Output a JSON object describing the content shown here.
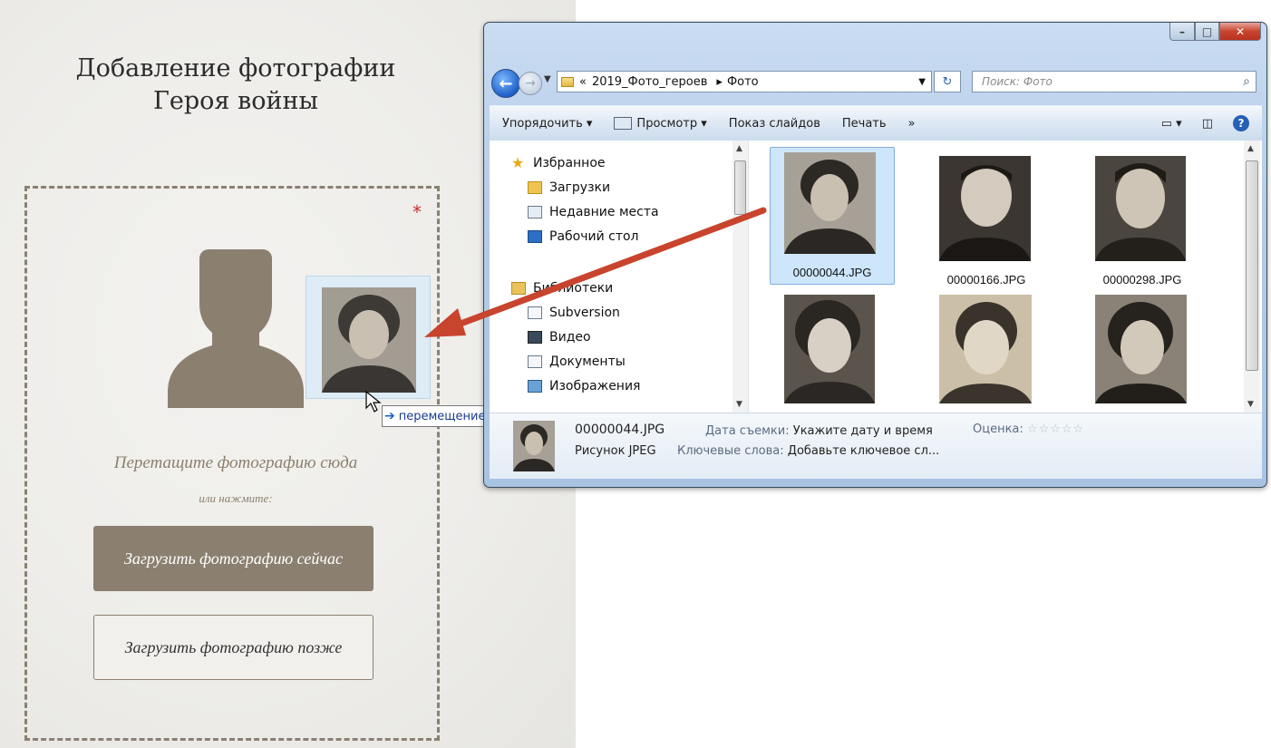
{
  "webpage": {
    "title_line1": "Добавление фотографии",
    "title_line2": "Героя войны",
    "required_mark": "*",
    "drop_hint": "Перетащите фотографию сюда",
    "or_click": "или нажмите:",
    "upload_now_label": "Загрузить фотографию сейчас",
    "upload_later_label": "Загрузить фотографию позже",
    "drag_tooltip": "перемещение",
    "accent_color": "#8b8070"
  },
  "explorer": {
    "address": {
      "overflow": "«",
      "crumbs": [
        "2019_Фото_героев",
        "Фото"
      ],
      "search_placeholder": "Поиск: Фото"
    },
    "toolbar": {
      "organize": "Упорядочить ▾",
      "view": "Просмотр ▾",
      "slideshow": "Показ слайдов",
      "print": "Печать",
      "more": "»"
    },
    "nav": {
      "favorites": "Избранное",
      "downloads": "Загрузки",
      "recent": "Недавние места",
      "desktop": "Рабочий стол",
      "libraries": "Библиотеки",
      "subversion": "Subversion",
      "video": "Видео",
      "documents": "Документы",
      "images": "Изображения"
    },
    "files": [
      {
        "name": "00000044.JPG",
        "selected": true
      },
      {
        "name": "00000166.JPG",
        "selected": false
      },
      {
        "name": "00000298.JPG",
        "selected": false
      },
      {
        "name": "",
        "selected": false
      },
      {
        "name": "",
        "selected": false
      },
      {
        "name": "",
        "selected": false
      }
    ],
    "details": {
      "filename": "00000044.JPG",
      "type": "Рисунок JPEG",
      "date_label": "Дата съемки:",
      "date_value": "Укажите дату и время",
      "keywords_label": "Ключевые слова:",
      "keywords_value": "Добавьте ключевое сл...",
      "rating_label": "Оценка:",
      "rating_value": "☆☆☆☆☆"
    }
  }
}
